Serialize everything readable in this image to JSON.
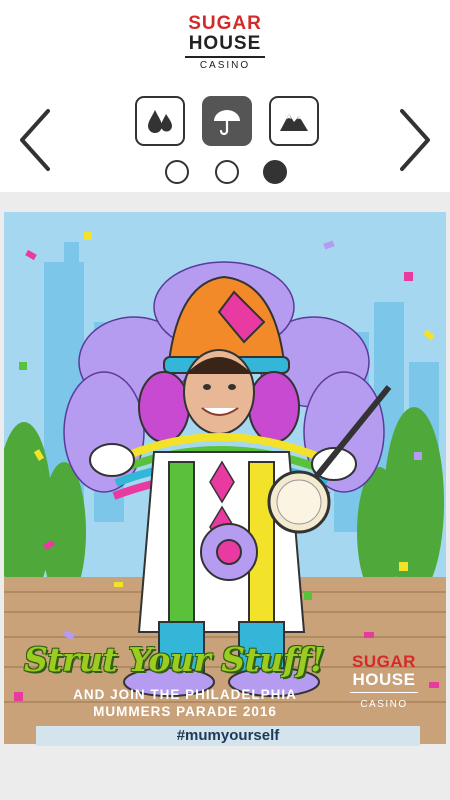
{
  "header": {
    "logo": {
      "line1": "SUGAR",
      "line2": "HOUSE",
      "line3": "CASINO"
    },
    "nav": {
      "prev_icon": "chevron-left-icon",
      "next_icon": "chevron-right-icon"
    },
    "tools": [
      {
        "icon": "drops-icon",
        "active": false
      },
      {
        "icon": "umbrella-icon",
        "active": true
      },
      {
        "icon": "mountains-icon",
        "active": false
      }
    ],
    "pager": {
      "count": 3,
      "selected": 3
    }
  },
  "poster": {
    "headline": "Strut Your Stuff!",
    "sub_line1": "AND JOIN THE PHILADELPHIA",
    "sub_line2": "MUMMERS PARADE 2016",
    "brand": {
      "line1": "SUGAR",
      "line2": "HOUSE",
      "line3": "CASINO"
    },
    "hashtag": "#mumyourself"
  },
  "colors": {
    "brand_red": "#d42a2a",
    "headline_green": "#9ccc1f",
    "sky": "#a5d8f0",
    "stage": "#c9a27a"
  }
}
